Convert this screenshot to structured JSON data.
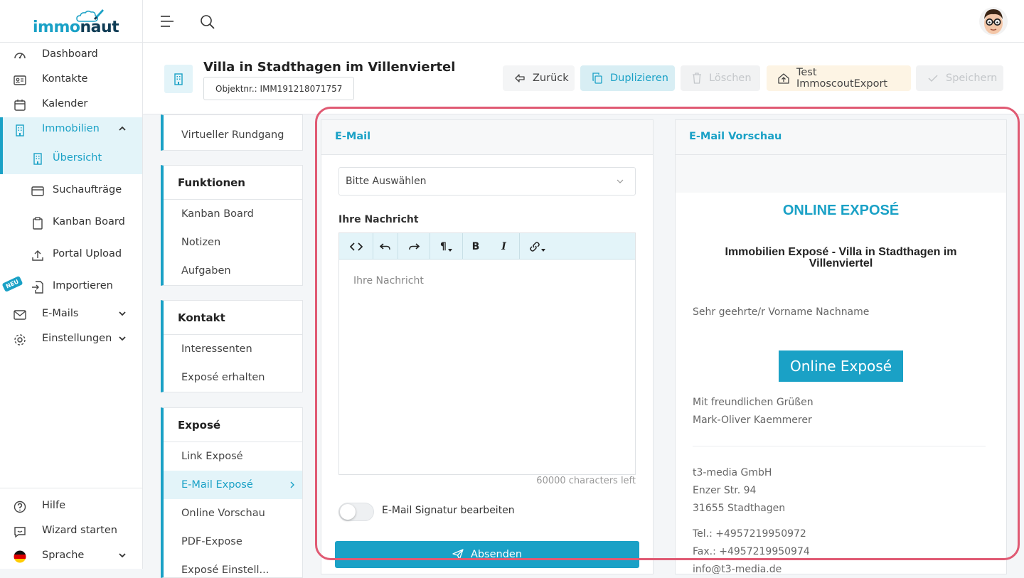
{
  "logo": {
    "part1": "immo",
    "part2": "naut"
  },
  "nav": {
    "dashboard": "Dashboard",
    "kontakte": "Kontakte",
    "kalender": "Kalender",
    "immobilien": "Immobilien",
    "uebersicht": "Übersicht",
    "suchauftraege": "Suchaufträge",
    "kanban": "Kanban Board",
    "portal_upload": "Portal Upload",
    "neu_badge": "NEU",
    "importieren": "Importieren",
    "emails": "E-Mails",
    "einstellungen": "Einstellungen",
    "hilfe": "Hilfe",
    "wizard": "Wizard starten",
    "sprache": "Sprache"
  },
  "header": {
    "title": "Villa in Stadthagen im Villenviertel",
    "objektnr": "Objektnr.: IMM191218071757"
  },
  "actions": {
    "zurueck": "Zurück",
    "duplizieren": "Duplizieren",
    "loeschen": "Löschen",
    "test_export": "Test ImmoscoutExport",
    "speichern": "Speichern"
  },
  "leftnav": {
    "virtueller_rundgang": "Virtueller Rundgang",
    "funktionen": {
      "title": "Funktionen",
      "items": [
        "Kanban Board",
        "Notizen",
        "Aufgaben"
      ]
    },
    "kontakt": {
      "title": "Kontakt",
      "items": [
        "Interessenten",
        "Exposé erhalten"
      ]
    },
    "expose": {
      "title": "Exposé",
      "items": [
        "Link Exposé",
        "E-Mail Exposé",
        "Online Vorschau",
        "PDF-Expose",
        "Exposé Einstell..."
      ]
    }
  },
  "email_panel": {
    "title": "E-Mail",
    "select_value": "Bitte Auswählen",
    "message_label": "Ihre Nachricht",
    "editor_placeholder": "Ihre Nachricht",
    "char_count": "60000 characters left",
    "signature_toggle": "E-Mail Signatur bearbeiten",
    "send_button": "Absenden"
  },
  "preview_panel": {
    "title": "E-Mail Vorschau",
    "heading": "ONLINE EXPOSÉ",
    "subheading_line1": "Immobilien Exposé - Villa in Stadthagen im",
    "subheading_line2": "Villenviertel",
    "greeting": "Sehr geehrte/r Vorname Nachname",
    "cta_button": "Online Exposé",
    "closing": "Mit freundlichen Grüßen",
    "sender": "Mark-Oliver Kaemmerer",
    "company": "t3-media GmbH",
    "street": "Enzer Str. 94",
    "city": "31655 Stadthagen",
    "tel": "Tel.: +4957219950972",
    "fax": "Fax.: +4957219950974",
    "email": "info@t3-media.de"
  },
  "colors": {
    "accent": "#1aa1c6",
    "highlight_border": "#e05a73",
    "send_button": "#1aa1c6"
  }
}
